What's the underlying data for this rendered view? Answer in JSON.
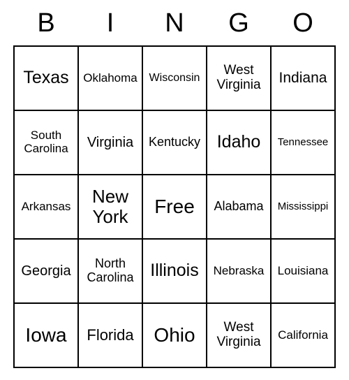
{
  "header": [
    "B",
    "I",
    "N",
    "G",
    "O"
  ],
  "grid": [
    [
      {
        "text": "Texas",
        "size": 25
      },
      {
        "text": "Oklahoma",
        "size": 17
      },
      {
        "text": "Wisconsin",
        "size": 16
      },
      {
        "text": "West Virginia",
        "size": 19
      },
      {
        "text": "Indiana",
        "size": 21
      }
    ],
    [
      {
        "text": "South Carolina",
        "size": 17
      },
      {
        "text": "Virginia",
        "size": 20
      },
      {
        "text": "Kentucky",
        "size": 18
      },
      {
        "text": "Idaho",
        "size": 25
      },
      {
        "text": "Tennessee",
        "size": 15
      }
    ],
    [
      {
        "text": "Arkansas",
        "size": 17
      },
      {
        "text": "New York",
        "size": 26
      },
      {
        "text": "Free",
        "size": 28
      },
      {
        "text": "Alabama",
        "size": 18
      },
      {
        "text": "Mississippi",
        "size": 15
      }
    ],
    [
      {
        "text": "Georgia",
        "size": 20
      },
      {
        "text": "North Carolina",
        "size": 18
      },
      {
        "text": "Illinois",
        "size": 25
      },
      {
        "text": "Nebraska",
        "size": 17
      },
      {
        "text": "Louisiana",
        "size": 17
      }
    ],
    [
      {
        "text": "Iowa",
        "size": 28
      },
      {
        "text": "Florida",
        "size": 22
      },
      {
        "text": "Ohio",
        "size": 28
      },
      {
        "text": "West Virginia",
        "size": 19
      },
      {
        "text": "California",
        "size": 17
      }
    ]
  ]
}
